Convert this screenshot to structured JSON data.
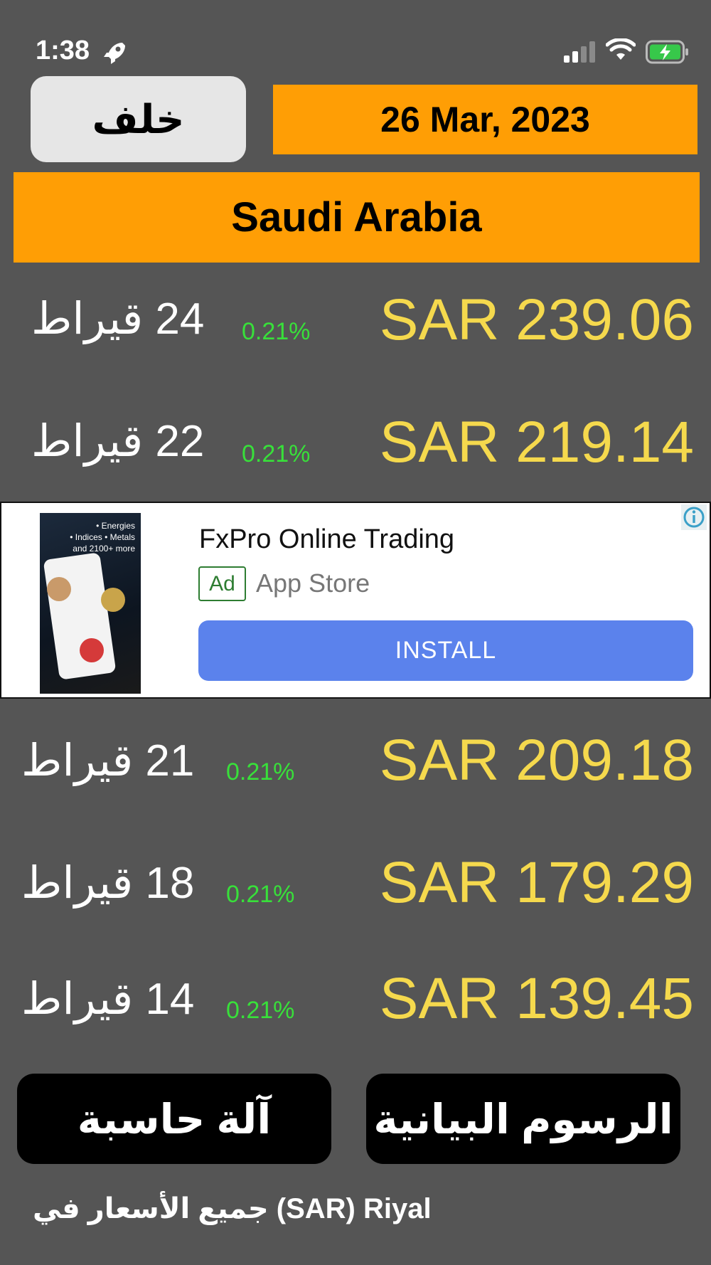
{
  "status_bar": {
    "time": "1:38",
    "icons": [
      "rocket-icon",
      "signal-icon",
      "wifi-icon",
      "battery-charging-icon"
    ]
  },
  "header": {
    "back_label": "خلف",
    "date": "26 Mar, 2023",
    "country": "Saudi Arabia"
  },
  "prices_top": [
    {
      "karat": "24 قيراط",
      "change": "0.21%",
      "price": "SAR 239.06"
    },
    {
      "karat": "22 قيراط",
      "change": "0.21%",
      "price": "SAR 219.14"
    }
  ],
  "ad": {
    "image_text": "• Energies\n• Indices • Metals\nand 2100+ more",
    "title": "FxPro Online Trading",
    "badge": "Ad",
    "store": "App Store",
    "install": "INSTALL"
  },
  "prices_bottom": [
    {
      "karat": "21 قيراط",
      "change": "0.21%",
      "price": "SAR 209.18"
    },
    {
      "karat": "18 قيراط",
      "change": "0.21%",
      "price": "SAR 179.29"
    },
    {
      "karat": "14 قيراط",
      "change": "0.21%",
      "price": "SAR 139.45"
    }
  ],
  "buttons": {
    "calculator": "آلة حاسبة",
    "charts": "الرسوم البيانية"
  },
  "footer": {
    "note": "جميع الأسعار في (SAR) Riyal"
  },
  "colors": {
    "background": "#555555",
    "accent": "#ff9e05",
    "price": "#f5d94d",
    "change_positive": "#38e03a",
    "install_button": "#5b82ec"
  }
}
